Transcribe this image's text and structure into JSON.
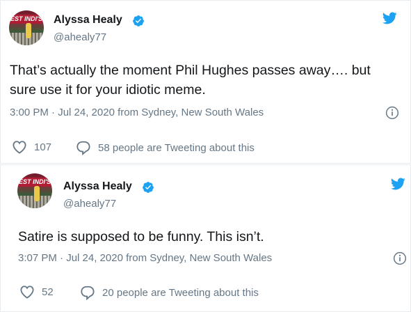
{
  "colors": {
    "twitter_blue": "#1da1f2",
    "text": "#14171a",
    "muted": "#657786"
  },
  "tweets": [
    {
      "avatar_banner": "EST INDI'S",
      "author_name": "Alyssa Healy",
      "handle": "@ahealy77",
      "text": "That’s actually the moment Phil Hughes passes away…. but sure use it for your idiotic meme.",
      "timestamp": "3:00 PM · Jul 24, 2020 from Sydney, New South Wales",
      "likes": "107",
      "conversation": "58 people are Tweeting about this"
    },
    {
      "avatar_banner": "EST INDI'S",
      "author_name": "Alyssa Healy",
      "handle": "@ahealy77",
      "text": "Satire is supposed to be funny. This isn’t.",
      "timestamp": "3:07 PM · Jul 24, 2020 from Sydney, New South Wales",
      "likes": "52",
      "conversation": "20 people are Tweeting about this"
    }
  ]
}
